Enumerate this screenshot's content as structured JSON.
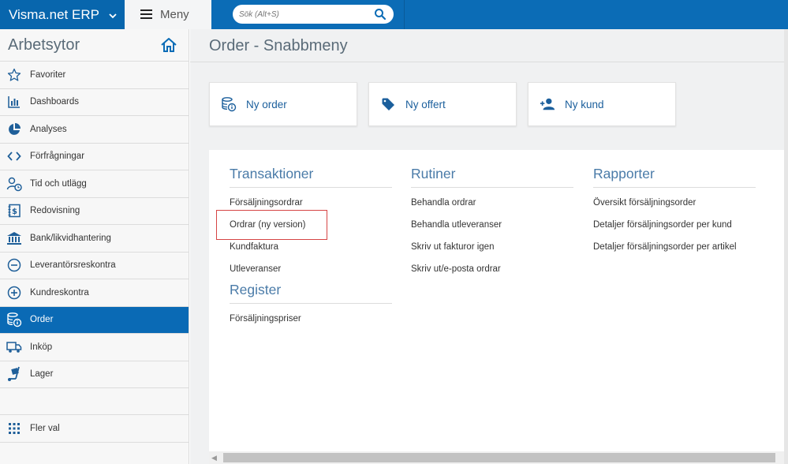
{
  "topbar": {
    "brand": "Visma.net ERP",
    "menu_label": "Meny",
    "search_placeholder": "Sök (Alt+S)",
    "colors": {
      "bar": "#0b6cb6",
      "brand_bg": "#0866ad"
    }
  },
  "sidebar": {
    "title": "Arbetsytor",
    "items": [
      {
        "label": "Favoriter",
        "icon": "star-icon"
      },
      {
        "label": "Dashboards",
        "icon": "bar-chart-icon"
      },
      {
        "label": "Analyses",
        "icon": "pie-chart-icon"
      },
      {
        "label": "Förfrågningar",
        "icon": "code-brackets-icon"
      },
      {
        "label": "Tid och utlägg",
        "icon": "person-clock-icon"
      },
      {
        "label": "Redovisning",
        "icon": "ledger-icon"
      },
      {
        "label": "Bank/likvidhantering",
        "icon": "bank-icon"
      },
      {
        "label": "Leverantörsreskontra",
        "icon": "minus-circle-icon"
      },
      {
        "label": "Kundreskontra",
        "icon": "plus-circle-icon"
      },
      {
        "label": "Order",
        "icon": "order-icon",
        "active": true
      },
      {
        "label": "Inköp",
        "icon": "truck-icon"
      },
      {
        "label": "Lager",
        "icon": "hand-truck-icon"
      }
    ],
    "more_label": "Fler val",
    "active_color": "#0a6ab5"
  },
  "main": {
    "page_title": "Order - Snabbmeny",
    "tiles": [
      {
        "label": "Ny order",
        "icon": "order-icon"
      },
      {
        "label": "Ny offert",
        "icon": "tag-icon"
      },
      {
        "label": "Ny kund",
        "icon": "add-user-icon"
      }
    ],
    "columns": {
      "transaktioner": {
        "title": "Transaktioner",
        "links": [
          "Försäljningsordrar",
          "Ordrar (ny version)",
          "Kundfaktura",
          "Utleveranser"
        ]
      },
      "register": {
        "title": "Register",
        "links": [
          "Försäljningspriser"
        ]
      },
      "rutiner": {
        "title": "Rutiner",
        "links": [
          "Behandla ordrar",
          "Behandla utleveranser",
          "Skriv ut fakturor igen",
          "Skriv ut/e-posta ordrar"
        ]
      },
      "rapporter": {
        "title": "Rapporter",
        "links": [
          "Översikt försäljningsorder",
          "Detaljer försäljningsorder per kund",
          "Detaljer försäljningsorder per artikel"
        ]
      }
    },
    "highlight_color": "#d64545"
  }
}
